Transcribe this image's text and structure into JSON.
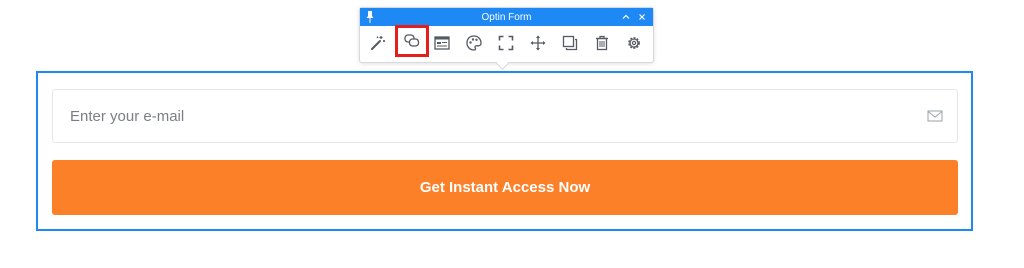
{
  "toolbar": {
    "title": "Optin Form",
    "header_buttons": [
      {
        "icon": "chevron-up-icon"
      },
      {
        "icon": "close-icon"
      }
    ],
    "tools": [
      {
        "icon": "magic-wand-icon"
      },
      {
        "icon": "chat-bubbles-icon",
        "selected": true
      },
      {
        "icon": "form-fields-icon"
      },
      {
        "icon": "palette-icon"
      },
      {
        "icon": "fullscreen-corners-icon"
      },
      {
        "icon": "move-arrows-icon"
      },
      {
        "icon": "duplicate-icon"
      },
      {
        "icon": "trash-icon"
      },
      {
        "icon": "gear-icon"
      }
    ],
    "colors": {
      "header": "#1e88f5",
      "selected_outline": "#e51d1d"
    }
  },
  "form": {
    "email_placeholder": "Enter your e-mail",
    "email_icon": "envelope-icon",
    "button_label": "Get Instant Access Now",
    "colors": {
      "button": "#fb8028",
      "frame": "#1e88f5"
    }
  }
}
